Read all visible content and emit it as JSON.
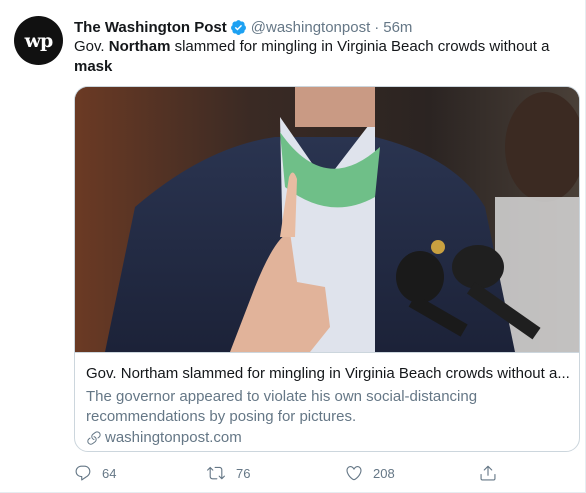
{
  "tweet": {
    "author_name": "The Washington Post",
    "handle": "@washingtonpost",
    "separator": "·",
    "time": "56m",
    "avatar_text": "wp",
    "text_part1": "Gov. ",
    "text_bold1": "Northam",
    "text_part2": " slammed for mingling in Virginia Beach crowds without a ",
    "text_bold2": "mask"
  },
  "card": {
    "title": "Gov. Northam slammed for mingling in Virginia Beach crowds without a...",
    "description": "The governor appeared to violate his own social-distancing recommendations by posing for pictures.",
    "domain": "washingtonpost.com"
  },
  "actions": {
    "reply_count": "64",
    "retweet_count": "76",
    "like_count": "208"
  },
  "colors": {
    "verified": "#1da1f2",
    "secondary_text": "#657786",
    "border": "#ccd6dd"
  },
  "icons": [
    "verified-badge-icon",
    "link-icon",
    "reply-icon",
    "retweet-icon",
    "like-icon",
    "share-icon"
  ]
}
